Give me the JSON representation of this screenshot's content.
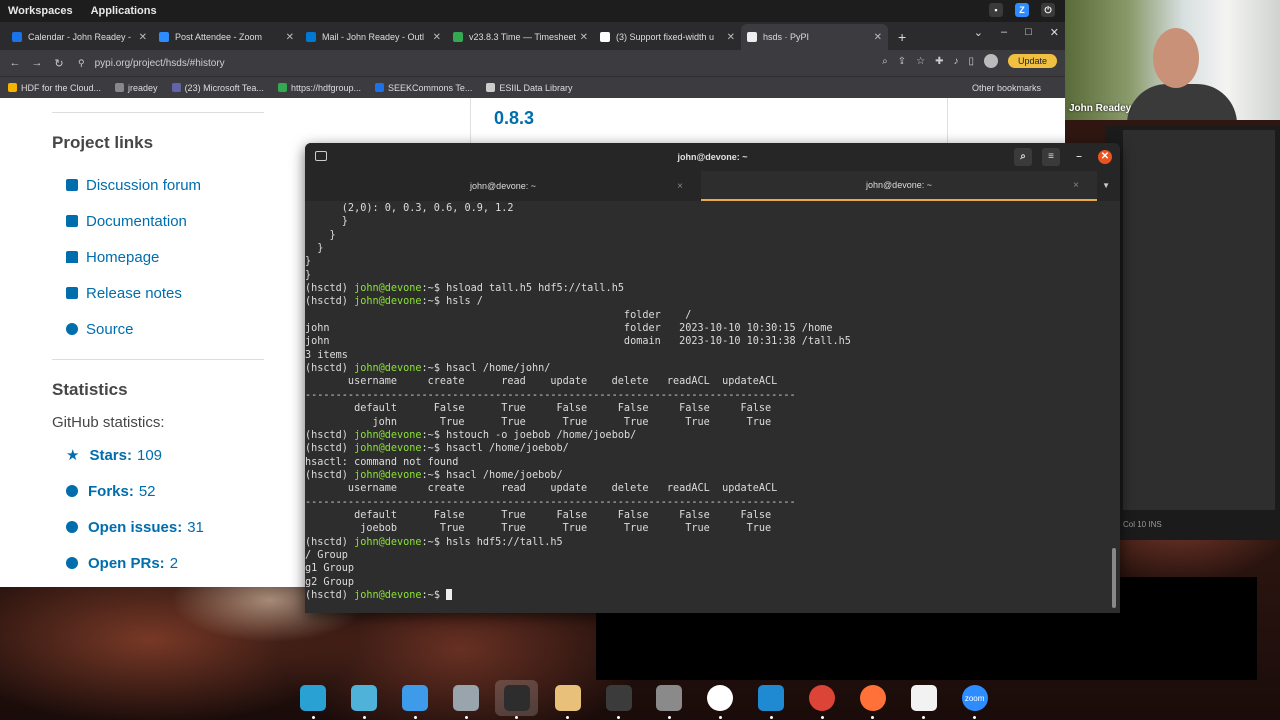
{
  "topbar": {
    "workspaces": "Workspaces",
    "applications": "Applications"
  },
  "browser": {
    "tabs": [
      {
        "title": "Calendar - John Readey - ",
        "color": "#1a73e8",
        "active": false
      },
      {
        "title": "Post Attendee - Zoom",
        "color": "#2d8cff",
        "active": false
      },
      {
        "title": "Mail - John Readey - Outl",
        "color": "#0078d4",
        "active": false
      },
      {
        "title": "v23.8.3 Time — Timesheet",
        "color": "#34a853",
        "active": false
      },
      {
        "title": "(3) Support fixed-width u",
        "color": "#ffffff",
        "active": false
      },
      {
        "title": "hsds · PyPI",
        "color": "#eeeeee",
        "active": true
      }
    ],
    "url": "pypi.org/project/hsds/#history",
    "update_label": "Update",
    "bookmarks": [
      {
        "label": "HDF for the Cloud...",
        "color": "#f4b400"
      },
      {
        "label": "jreadey",
        "color": "#888888"
      },
      {
        "label": "(23) Microsoft Tea...",
        "color": "#6264a7"
      },
      {
        "label": "https://hdfgroup...",
        "color": "#34a853"
      },
      {
        "label": "SEEKCommons Te...",
        "color": "#1a73e8"
      },
      {
        "label": "ESIIL Data Library",
        "color": "#cccccc"
      }
    ],
    "other_bookmarks": "Other bookmarks"
  },
  "page": {
    "project_links_heading": "Project links",
    "links": [
      "Discussion forum",
      "Documentation",
      "Homepage",
      "Release notes",
      "Source"
    ],
    "statistics_heading": "Statistics",
    "github_statistics": "GitHub statistics:",
    "stats": [
      {
        "label": "Stars:",
        "value": "109"
      },
      {
        "label": "Forks:",
        "value": "52"
      },
      {
        "label": "Open issues:",
        "value": "31"
      },
      {
        "label": "Open PRs:",
        "value": "2"
      }
    ],
    "version": "0.8.3"
  },
  "webcam": {
    "name": "John Readey"
  },
  "rightpanel": {
    "status": "Col 10      INS"
  },
  "terminal": {
    "title": "john@devone: ~",
    "tabs": [
      "john@devone: ~",
      "john@devone: ~"
    ],
    "prompt_prefix": "(hsctd) ",
    "prompt_user": "john@devone",
    "prompt_suffix": ":~$ ",
    "lines": [
      {
        "t": "      (2,0): 0, 0.3, 0.6, 0.9, 1.2"
      },
      {
        "t": "      }"
      },
      {
        "t": "    }"
      },
      {
        "t": "  }"
      },
      {
        "t": "}"
      },
      {
        "t": "}"
      },
      {
        "p": true,
        "t": "hsload tall.h5 hdf5://tall.h5"
      },
      {
        "p": true,
        "t": "hsls /"
      },
      {
        "t": "                                                    folder    /"
      },
      {
        "t": "john                                                folder   2023-10-10 10:30:15 /home"
      },
      {
        "t": "john                                                domain   2023-10-10 10:31:38 /tall.h5"
      },
      {
        "t": "3 items"
      },
      {
        "p": true,
        "t": "hsacl /home/john/"
      },
      {
        "t": "       username     create      read    update    delete   readACL  updateACL"
      },
      {
        "t": "--------------------------------------------------------------------------------"
      },
      {
        "t": "        default      False      True     False     False     False     False"
      },
      {
        "t": "           john       True      True      True      True      True      True"
      },
      {
        "p": true,
        "t": "hstouch -o joebob /home/joebob/"
      },
      {
        "p": true,
        "t": "hsactl /home/joebob/"
      },
      {
        "t": "hsactl: command not found"
      },
      {
        "p": true,
        "t": "hsacl /home/joebob/"
      },
      {
        "t": "       username     create      read    update    delete   readACL  updateACL"
      },
      {
        "t": "--------------------------------------------------------------------------------"
      },
      {
        "t": "        default      False      True     False     False     False     False"
      },
      {
        "t": "         joebob       True      True      True      True      True      True"
      },
      {
        "p": true,
        "t": "hsls hdf5://tall.h5"
      },
      {
        "t": "/ Group"
      },
      {
        "t": "g1 Group"
      },
      {
        "t": "g2 Group"
      },
      {
        "p": true,
        "t": "",
        "cursor": true
      }
    ]
  },
  "dock": [
    {
      "name": "search-app",
      "color": "#2aa1d3"
    },
    {
      "name": "screenshot-app",
      "color": "#4fb3d9"
    },
    {
      "name": "app-grid",
      "color": "#3d9be9"
    },
    {
      "name": "files-app",
      "color": "#9aa4ad"
    },
    {
      "name": "terminal-app",
      "color": "#2d2d2d",
      "active": true
    },
    {
      "name": "archive-app",
      "color": "#e8c07a"
    },
    {
      "name": "system-monitor-app",
      "color": "#3b3b3b"
    },
    {
      "name": "settings-app",
      "color": "#8a8a8a"
    },
    {
      "name": "slack-app",
      "color": "#ffffff"
    },
    {
      "name": "vscode-app",
      "color": "#1f8ad2"
    },
    {
      "name": "chrome-app",
      "color": "#db4437"
    },
    {
      "name": "firefox-app",
      "color": "#ff7139"
    },
    {
      "name": "text-editor-app",
      "color": "#f2f2f2"
    },
    {
      "name": "zoom-app",
      "color": "#2d8cff",
      "label": "zoom"
    }
  ]
}
